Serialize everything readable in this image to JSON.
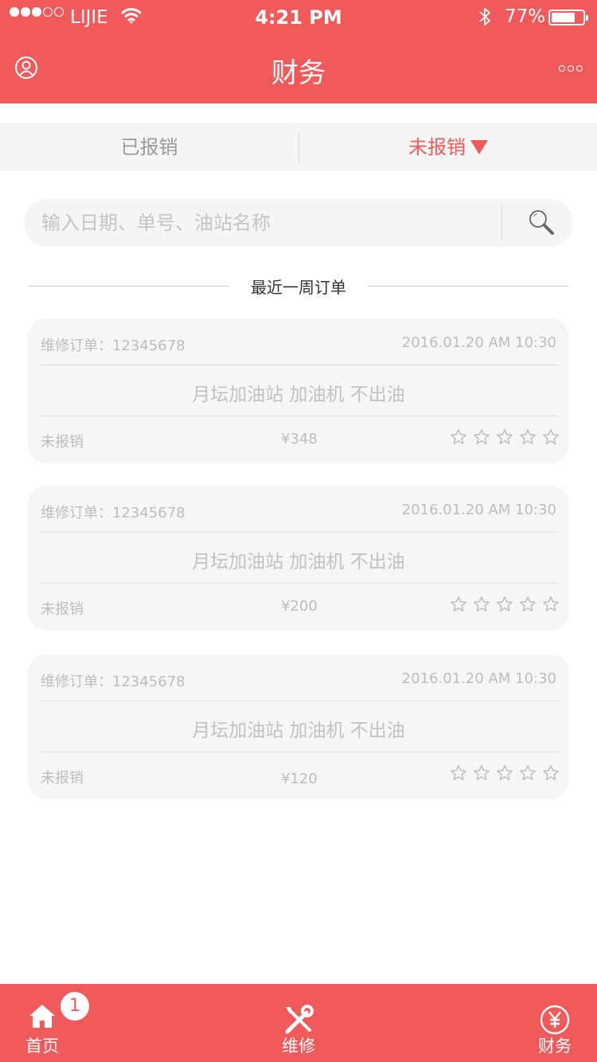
{
  "status_bar": {
    "carrier": "LIJIE",
    "time": "4:21 PM",
    "battery_pct": "77%",
    "battery_level": 0.77,
    "signal_bars_filled": 3,
    "signal_bars_total": 5
  },
  "header": {
    "title": "财务",
    "left_icon": "user-icon",
    "right_icon": "more-icon"
  },
  "tabs": {
    "left_label": "已报销",
    "right_label": "未报销",
    "active": "未报销"
  },
  "search": {
    "placeholder": "输入日期、单号、油站名称",
    "icon": "magnifier-icon"
  },
  "section": {
    "title": "最近一周订单"
  },
  "orders": [
    {
      "order_label": "维修订单：12345678",
      "datetime": "2016.01.20  AM 10:30",
      "description": "月坛加油站  加油机  不出油",
      "status": "未报销",
      "price": "¥348",
      "rating": 0,
      "rating_max": 5
    },
    {
      "order_label": "维修订单：12345678",
      "datetime": "2016.01.20  AM 10:30",
      "description": "月坛加油站  加油机  不出油",
      "status": "未报销",
      "price": "¥200",
      "rating": 0,
      "rating_max": 5
    },
    {
      "order_label": "维修订单：12345678",
      "datetime": "2016.01.20  AM 10:30",
      "description": "月坛加油站  加油机  不出油",
      "status": "未报销",
      "price": "¥120",
      "rating": 0,
      "rating_max": 5
    }
  ],
  "tabbar": {
    "items": [
      {
        "label": "首页",
        "icon": "home-icon",
        "badge": "1"
      },
      {
        "label": "维修",
        "icon": "tools-icon"
      },
      {
        "label": "财务",
        "icon": "yen-circle-icon"
      }
    ]
  },
  "colors": {
    "accent": "#f05a5b",
    "card_bg": "#f6f6f6",
    "muted_text": "#bdbdbd"
  }
}
